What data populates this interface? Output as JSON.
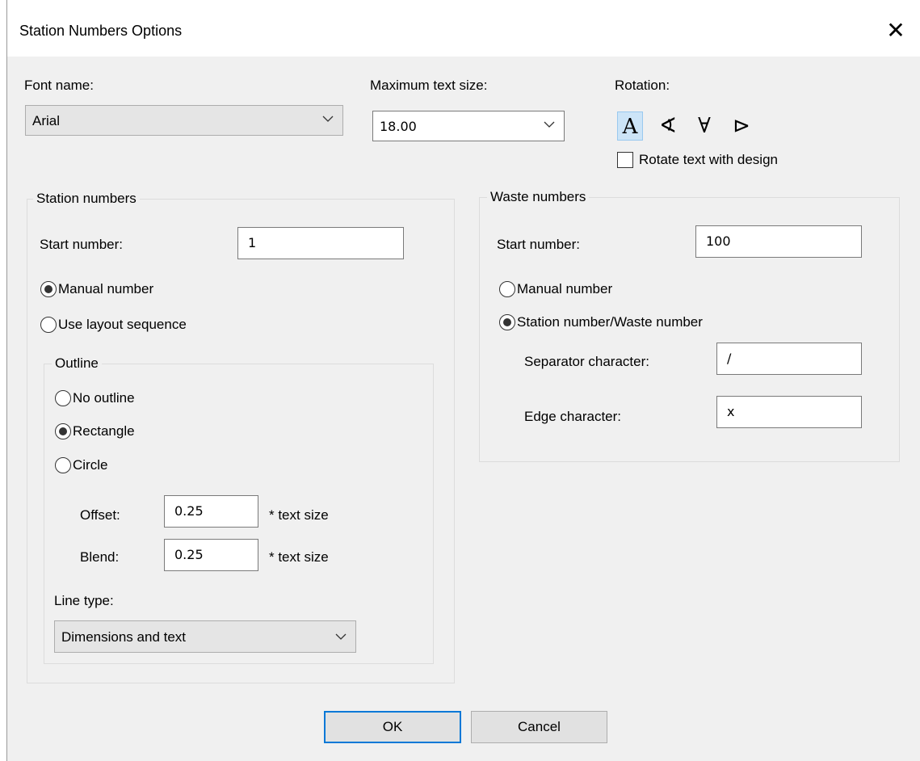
{
  "window": {
    "title": "Station Numbers Options",
    "close_symbol": "✕"
  },
  "font": {
    "label": "Font name:",
    "value": "Arial"
  },
  "max_text_size": {
    "label": "Maximum text size:",
    "value": "18.00"
  },
  "rotation": {
    "label": "Rotation:",
    "options": [
      "A",
      "∢",
      "∀",
      "⊳"
    ],
    "selected_index": 0,
    "rotate_with_design_label": "Rotate text with design",
    "rotate_with_design_checked": false
  },
  "station_numbers": {
    "title": "Station numbers",
    "start_label": "Start number:",
    "start_value": "1",
    "manual_label": "Manual number",
    "layout_label": "Use layout sequence",
    "selected": "manual",
    "outline": {
      "title": "Outline",
      "no_outline_label": "No outline",
      "rectangle_label": "Rectangle",
      "circle_label": "Circle",
      "selected": "rectangle",
      "offset_label": "Offset:",
      "offset_value": "0.25",
      "offset_unit": "* text size",
      "blend_label": "Blend:",
      "blend_value": "0.25",
      "blend_unit": "* text size",
      "line_type_label": "Line type:",
      "line_type_value": "Dimensions and text"
    }
  },
  "waste_numbers": {
    "title": "Waste numbers",
    "start_label": "Start number:",
    "start_value": "100",
    "manual_label": "Manual number",
    "station_waste_label": "Station number/Waste number",
    "selected": "station_waste",
    "separator_label": "Separator character:",
    "separator_value": "/",
    "edge_label": "Edge character:",
    "edge_value": "x"
  },
  "buttons": {
    "ok": "OK",
    "cancel": "Cancel"
  }
}
